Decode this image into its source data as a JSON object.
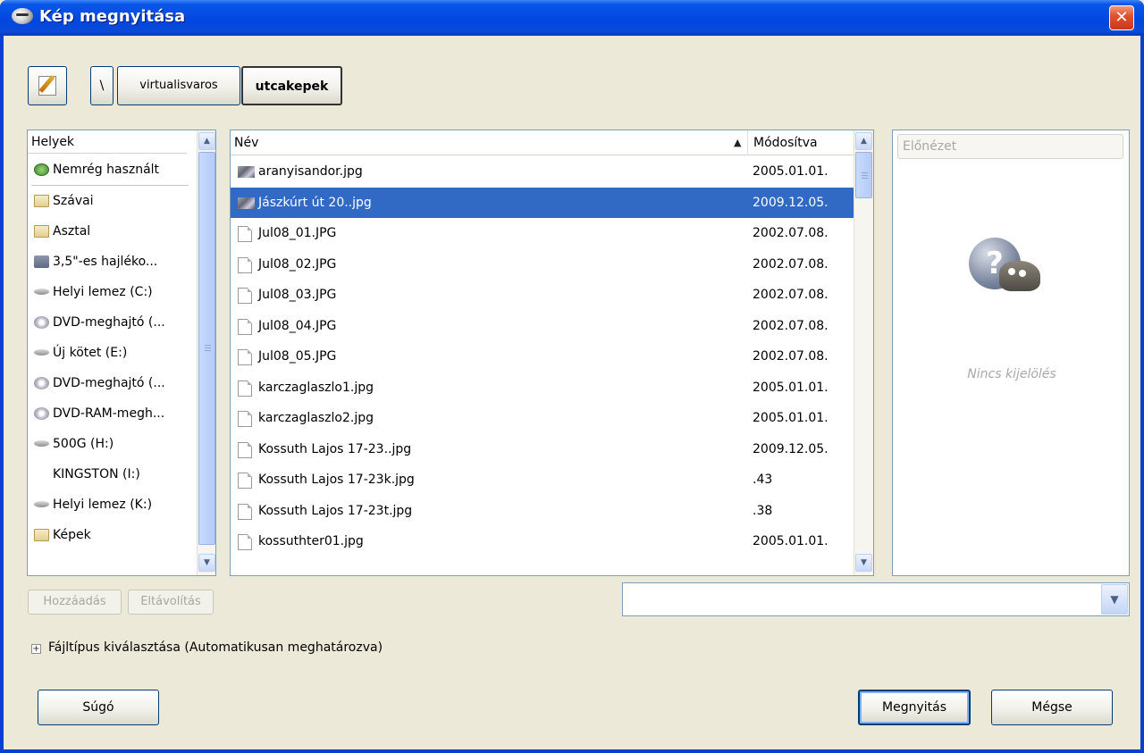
{
  "window": {
    "title": "Kép megnyitása",
    "close_label": "✕"
  },
  "breadcrumb": {
    "items": [
      "\\",
      "virtualisvaros",
      "utcakepek"
    ]
  },
  "places": {
    "header": "Helyek",
    "recent": {
      "label": "Nemrég használt",
      "icon": "recent-icon"
    },
    "items": [
      {
        "label": "Szávai",
        "icon": "folder-icon"
      },
      {
        "label": "Asztal",
        "icon": "folder-icon"
      },
      {
        "label": "3,5\"-es hajléko...",
        "icon": "floppy-icon"
      },
      {
        "label": "Helyi lemez (C:)",
        "icon": "hard-drive-icon"
      },
      {
        "label": "DVD-meghajtó (...",
        "icon": "dvd-drive-icon"
      },
      {
        "label": "Új kötet (E:)",
        "icon": "hard-drive-icon"
      },
      {
        "label": "DVD-meghajtó (...",
        "icon": "dvd-drive-icon"
      },
      {
        "label": "DVD-RAM-megh...",
        "icon": "dvd-drive-icon"
      },
      {
        "label": "500G (H:)",
        "icon": "hard-drive-icon"
      },
      {
        "label": "KINGSTON (I:)",
        "icon": "none"
      },
      {
        "label": "Helyi lemez (K:)",
        "icon": "hard-drive-icon"
      },
      {
        "label": "Képek",
        "icon": "folder-icon"
      }
    ]
  },
  "files": {
    "columns": {
      "name": "Név",
      "modified": "Módosítva"
    },
    "rows": [
      {
        "name": "aranyisandor.jpg",
        "modified": "2005.01.01.",
        "icon": "image-thumbnail-icon",
        "selected": false
      },
      {
        "name": "Jászkúrt út 20..jpg",
        "modified": "2009.12.05.",
        "icon": "image-thumbnail-icon",
        "selected": true
      },
      {
        "name": "Jul08_01.JPG",
        "modified": "2002.07.08.",
        "icon": "document-icon",
        "selected": false
      },
      {
        "name": "Jul08_02.JPG",
        "modified": "2002.07.08.",
        "icon": "document-icon",
        "selected": false
      },
      {
        "name": "Jul08_03.JPG",
        "modified": "2002.07.08.",
        "icon": "document-icon",
        "selected": false
      },
      {
        "name": "Jul08_04.JPG",
        "modified": "2002.07.08.",
        "icon": "document-icon",
        "selected": false
      },
      {
        "name": "Jul08_05.JPG",
        "modified": "2002.07.08.",
        "icon": "document-icon",
        "selected": false
      },
      {
        "name": "karczaglaszlo1.jpg",
        "modified": "2005.01.01.",
        "icon": "document-icon",
        "selected": false
      },
      {
        "name": "karczaglaszlo2.jpg",
        "modified": "2005.01.01.",
        "icon": "document-icon",
        "selected": false
      },
      {
        "name": "Kossuth Lajos 17-23..jpg",
        "modified": "2009.12.05.",
        "icon": "document-icon",
        "selected": false
      },
      {
        "name": "Kossuth Lajos 17-23k.jpg",
        "modified": ".43",
        "icon": "document-icon",
        "selected": false
      },
      {
        "name": "Kossuth Lajos 17-23t.jpg",
        "modified": ".38",
        "icon": "document-icon",
        "selected": false
      },
      {
        "name": "kossuthter01.jpg",
        "modified": "2005.01.01.",
        "icon": "document-icon",
        "selected": false
      }
    ]
  },
  "preview": {
    "header": "Előnézet",
    "empty_text": "Nincs kijelölés"
  },
  "buttons": {
    "add": "Hozzáadás",
    "remove": "Eltávolítás",
    "help": "Súgó",
    "open": "Megnyitás",
    "cancel": "Mégse"
  },
  "filetype": {
    "expander_symbol": "+",
    "label": "Fájltípus kiválasztása (Automatikusan meghatározva)"
  },
  "colors": {
    "selection": "#316ac5",
    "titlebar": "#0a56e8",
    "face": "#ece9d8"
  }
}
